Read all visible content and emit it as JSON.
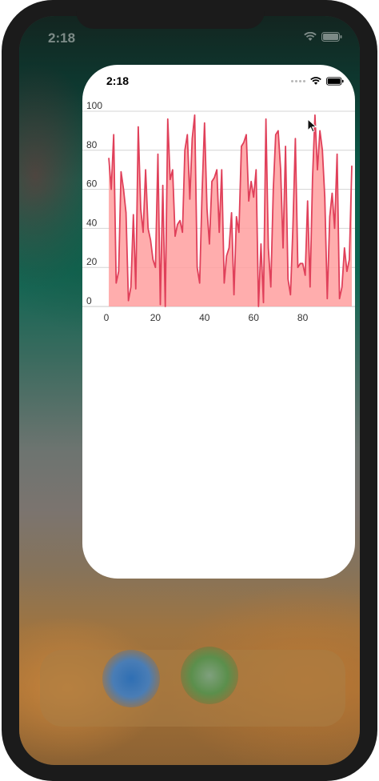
{
  "device": {
    "home_time": "2:18",
    "app_status_time": "2:18"
  },
  "colors": {
    "series_line": "#e0405a",
    "series_fill": "#ff9f9f",
    "grid": "#d4d4d4",
    "baseline": "#c8c8c8"
  },
  "icons": {
    "wifi": "wifi-icon",
    "battery": "battery-icon",
    "signal": "signal-dots-icon",
    "cursor": "mouse-pointer-icon"
  },
  "chart_data": {
    "type": "area",
    "title": "",
    "xlabel": "",
    "ylabel": "",
    "xlim": [
      0,
      100
    ],
    "ylim": [
      0,
      100
    ],
    "x_ticks": [
      "0",
      "20",
      "40",
      "60",
      "80"
    ],
    "y_ticks": [
      "0",
      "20",
      "40",
      "60",
      "80",
      "100"
    ],
    "grid": true,
    "legend": "none",
    "series": [
      {
        "x": [
          1,
          2,
          3,
          4,
          5,
          6,
          7,
          8,
          9,
          10,
          11,
          12,
          13,
          14,
          15,
          16,
          17,
          18,
          19,
          20,
          21,
          22,
          23,
          24,
          25,
          26,
          27,
          28,
          29,
          30,
          31,
          32,
          33,
          34,
          35,
          36,
          37,
          38,
          39,
          40,
          41,
          42,
          43,
          44,
          45,
          46,
          47,
          48,
          49,
          50,
          51,
          52,
          53,
          54,
          55,
          56,
          57,
          58,
          59,
          60,
          61,
          62,
          63,
          64,
          65,
          66,
          67,
          68,
          69,
          70,
          71,
          72,
          73,
          74,
          75,
          76,
          77,
          78,
          79,
          80,
          81,
          82,
          83,
          84,
          85,
          86,
          87,
          88,
          89,
          90,
          91,
          92,
          93,
          94,
          95,
          96,
          97,
          98,
          99,
          100
        ],
        "y": [
          76,
          60,
          88,
          12,
          18,
          69,
          60,
          48,
          3,
          10,
          47,
          9,
          92,
          50,
          38,
          70,
          40,
          34,
          24,
          20,
          78,
          1,
          62,
          0,
          96,
          65,
          70,
          36,
          42,
          44,
          38,
          80,
          88,
          55,
          86,
          98,
          20,
          12,
          58,
          94,
          50,
          32,
          64,
          66,
          70,
          38,
          70,
          12,
          26,
          30,
          48,
          6,
          46,
          38,
          82,
          84,
          88,
          54,
          64,
          56,
          70,
          0,
          32,
          2,
          96,
          30,
          10,
          60,
          88,
          90,
          70,
          30,
          82,
          14,
          6,
          40,
          86,
          20,
          22,
          22,
          16,
          54,
          10,
          66,
          98,
          70,
          90,
          80,
          56,
          4,
          46,
          58,
          40,
          78,
          4,
          10,
          30,
          18,
          24,
          72
        ]
      }
    ]
  }
}
